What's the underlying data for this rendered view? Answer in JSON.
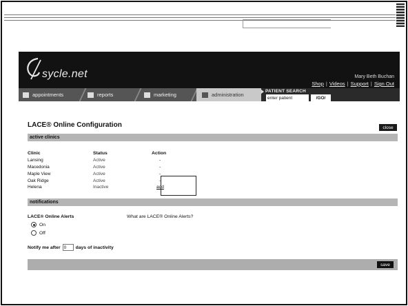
{
  "brand": {
    "name": "sycle.net"
  },
  "header": {
    "user_name": "Mary Beth Buchan",
    "links": [
      "Shop",
      "Videos",
      "Support",
      "Sign Out"
    ]
  },
  "tabs": [
    {
      "label": "appointments",
      "icon": "calendar-grid-icon"
    },
    {
      "label": "reports",
      "icon": "reports-icon"
    },
    {
      "label": "marketing",
      "icon": "envelope-icon"
    },
    {
      "label": "administration",
      "icon": "person-icon",
      "active": true
    }
  ],
  "patient_search": {
    "label": "PATIENT SEARCH",
    "input_value": "enter patient",
    "go_label": "/GO/"
  },
  "page": {
    "title": "LACE® Online Configuration",
    "close_label": "close"
  },
  "active_clinics": {
    "heading": "active clinics",
    "columns": [
      "Clinic",
      "Status",
      "Action"
    ],
    "rows": [
      {
        "clinic": "Lansing",
        "status": "Active",
        "action": "-"
      },
      {
        "clinic": "Macedonia",
        "status": "Active",
        "action": "-"
      },
      {
        "clinic": "Maple View",
        "status": "Active",
        "action": "-"
      },
      {
        "clinic": "Oak Ridge",
        "status": "Active",
        "action": "-"
      },
      {
        "clinic": "Helena",
        "status": "Inactive",
        "action": "add"
      }
    ]
  },
  "notifications": {
    "heading": "notifications",
    "alerts_label": "LACE® Online Alerts",
    "alerts_help": "What are LACE® Online Alerts?",
    "options": [
      {
        "label": "On",
        "selected": true
      },
      {
        "label": "Off",
        "selected": false
      }
    ],
    "notify_prefix": "Notify me after",
    "notify_value": "0",
    "notify_suffix": "days of inactivity"
  },
  "footer": {
    "save_label": "save"
  },
  "colors": {
    "header_bg": "#121212",
    "tabbar_bg": "#555555",
    "section_bar": "#b5b5b5",
    "button_bg": "#111111"
  }
}
